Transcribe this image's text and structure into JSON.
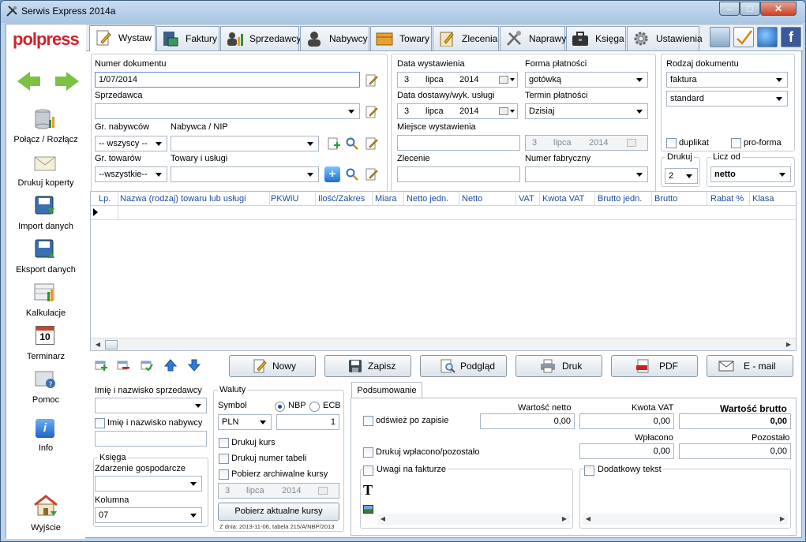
{
  "window": {
    "title": "Serwis Express 2014a"
  },
  "sidebar": {
    "logo": "polpress",
    "items": [
      {
        "label": "Połącz / Rozłącz"
      },
      {
        "label": "Drukuj koperty"
      },
      {
        "label": "Import danych"
      },
      {
        "label": "Eksport danych"
      },
      {
        "label": "Kalkulacje"
      },
      {
        "label": "Terminarz",
        "icon_text": "10"
      },
      {
        "label": "Pomoc"
      },
      {
        "label": "Info",
        "icon_text": "i"
      },
      {
        "label": "Wyjście"
      }
    ]
  },
  "tabs": [
    {
      "label": "Wystaw"
    },
    {
      "label": "Faktury"
    },
    {
      "label": "Sprzedawcy"
    },
    {
      "label": "Nabywcy"
    },
    {
      "label": "Towary"
    },
    {
      "label": "Zlecenia"
    },
    {
      "label": "Naprawy"
    },
    {
      "label": "Księga"
    },
    {
      "label": "Ustawienia"
    }
  ],
  "form": {
    "numer_label": "Numer dokumentu",
    "numer_value": "1/07/2014",
    "sprzedawca_label": "Sprzedawca",
    "gr_nabywcow_label": "Gr. nabywców",
    "gr_nabywcow_value": "-- wszyscy --",
    "nabywca_label": "Nabywca / NIP",
    "gr_towarow_label": "Gr. towarów",
    "gr_towarow_value": "--wszystkie--",
    "towary_label": "Towary i usługi",
    "data_wyst_label": "Data wystawienia",
    "data_wyst": {
      "day": "3",
      "month": "lipca",
      "year": "2014"
    },
    "forma_label": "Forma płatności",
    "forma_value": "gotówką",
    "data_dost_label": "Data dostawy/wyk. usługi",
    "data_dost": {
      "day": "3",
      "month": "lipca",
      "year": "2014"
    },
    "termin_label": "Termin płatności",
    "termin_value": "Dzisiaj",
    "miejsce_label": "Miejsce wystawienia",
    "termin_date": {
      "day": "3",
      "month": "lipca",
      "year": "2014"
    },
    "zlecenie_label": "Zlecenie",
    "numer_fabr_label": "Numer fabryczny",
    "rodzaj_label": "Rodzaj dokumentu",
    "rodzaj_value": "faktura",
    "rodzaj_sub_value": "standard",
    "duplikat_label": "duplikat",
    "proforma_label": "pro-forma",
    "drukuj_label": "Drukuj",
    "drukuj_value": "2",
    "licz_od_label": "Licz od",
    "licz_od_value": "netto"
  },
  "grid": {
    "columns": [
      "Lp.",
      "Nazwa (rodzaj) towaru lub usługi",
      "PKWiU",
      "Ilość/Zakres",
      "Miara",
      "Netto jedn.",
      "Netto",
      "VAT",
      "Kwota VAT",
      "Brutto jedn.",
      "Brutto",
      "Rabat %",
      "Klasa"
    ]
  },
  "actions": {
    "nowy": "Nowy",
    "zapisz": "Zapisz",
    "podglad": "Podgląd",
    "druk": "Druk",
    "pdf": "PDF",
    "email": "E - mail"
  },
  "bottom": {
    "sprzedawca_name_label": "Imię i nazwisko sprzedawcy",
    "nabywca_name_label": "Imię i nazwisko nabywcy",
    "ksiega_label": "Księga",
    "zdarzenie_label": "Zdarzenie gospodarcze",
    "kolumna_label": "Kolumna",
    "kolumna_value": "07",
    "waluty_label": "Waluty",
    "symbol_label": "Symbol",
    "nbp_label": "NBP",
    "ecb_label": "ECB",
    "symbol_value": "PLN",
    "kurs_value": "1",
    "drukuj_kurs_label": "Drukuj kurs",
    "drukuj_numer_label": "Drukuj numer tabeli",
    "pobierz_arch_label": "Pobierz archiwalne kursy",
    "arch_date": {
      "day": "3",
      "month": "lipca",
      "year": "2014"
    },
    "pobierz_btn": "Pobierz aktualne kursy",
    "kurs_info": "Z dnia: 2013-11-06, tabela 215/A/NBP/2013"
  },
  "summary": {
    "tab_label": "Podsumowanie",
    "odswiez_label": "odśwież po zapisie",
    "netto_label": "Wartość netto",
    "netto_value": "0,00",
    "vat_label": "Kwota VAT",
    "vat_value": "0,00",
    "brutto_label": "Wartość brutto",
    "brutto_value": "0,00",
    "drukuj_wplacono_label": "Drukuj wpłacono/pozostało",
    "wplacono_label": "Wpłacono",
    "wplacono_value": "0,00",
    "pozostalo_label": "Pozostało",
    "pozostalo_value": "0,00",
    "uwagi_label": "Uwagi na fakturze",
    "dodatkowy_label": "Dodatkowy tekst",
    "text_tool_icon": "T"
  },
  "colors": {
    "accent": "#1c4da1",
    "frame": "#bcd3ea"
  }
}
